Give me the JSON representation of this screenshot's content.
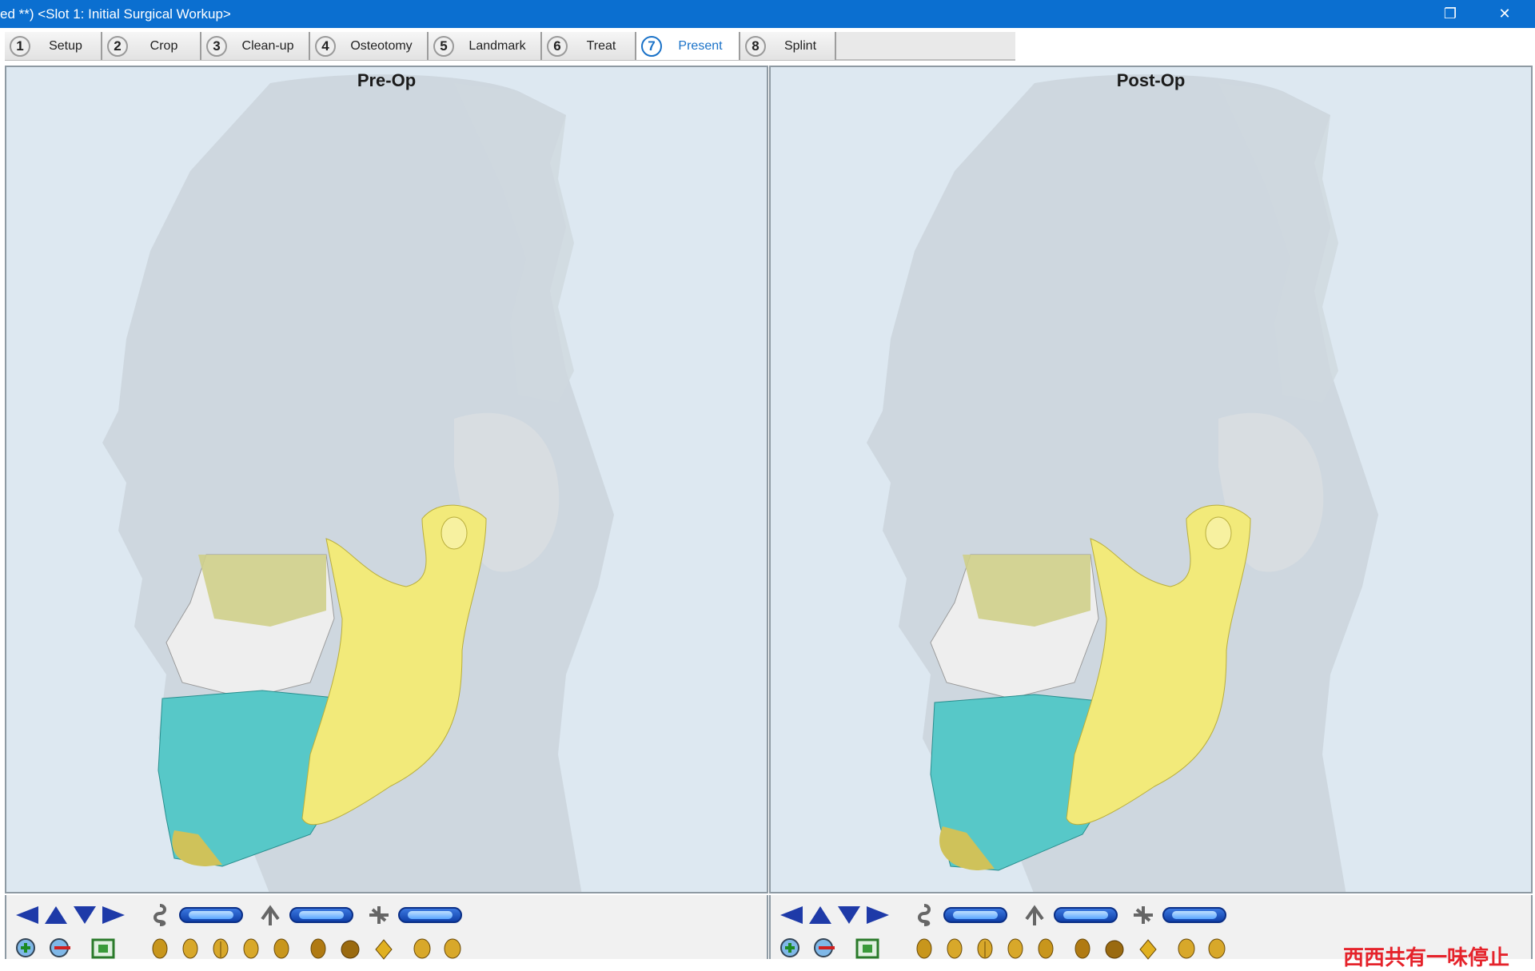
{
  "window": {
    "title": "ed **) <Slot 1: Initial Surgical Workup>",
    "restore_glyph": "❐",
    "close_glyph": "✕"
  },
  "steps": [
    {
      "num": "1",
      "label": "Setup",
      "active": false
    },
    {
      "num": "2",
      "label": "Crop",
      "active": false
    },
    {
      "num": "3",
      "label": "Clean-up",
      "active": false
    },
    {
      "num": "4",
      "label": "Osteotomy",
      "active": false
    },
    {
      "num": "5",
      "label": "Landmark",
      "active": false
    },
    {
      "num": "6",
      "label": "Treat",
      "active": false
    },
    {
      "num": "7",
      "label": "Present",
      "active": true
    },
    {
      "num": "8",
      "label": "Splint",
      "active": false
    }
  ],
  "viewports": {
    "left": {
      "title": "Pre-Op"
    },
    "right": {
      "title": "Post-Op"
    }
  },
  "controls": {
    "nav_arrows": [
      "arrow-left-icon",
      "arrow-up-icon",
      "arrow-down-icon",
      "arrow-right-icon"
    ],
    "rotation_controls": [
      "rotate-x-icon",
      "rotate-y-icon",
      "rotate-z-icon"
    ],
    "tools": [
      "zoom-in-icon",
      "zoom-out-icon",
      "fit-view-icon"
    ],
    "view_presets": [
      "view-left-icon",
      "view-left-oblique-icon",
      "view-front-icon",
      "view-right-oblique-icon",
      "view-right-icon",
      "view-back-icon",
      "view-top-icon",
      "view-bottom-icon",
      "view-three-quarter-left-icon",
      "view-three-quarter-right-icon"
    ]
  },
  "overlay_text": "西西共有一味停止",
  "colors": {
    "titlebar": "#0b6fd0",
    "viewport_bg": "#dde8f1",
    "mandible_yellow": "#f2ea7a",
    "teeth_cyan": "#57c8c8",
    "maxilla_white": "#eeeeee",
    "soft_tissue": "#c9d3da",
    "accent_blue": "#1a72c8",
    "arrow_blue": "#1e3aa8"
  }
}
